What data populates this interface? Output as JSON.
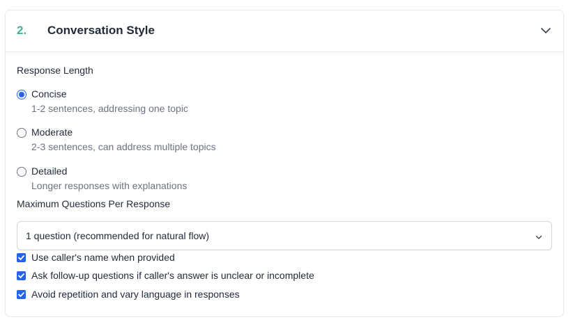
{
  "section": {
    "number": "2.",
    "title": "Conversation Style"
  },
  "response_length": {
    "label": "Response Length",
    "options": [
      {
        "label": "Concise",
        "description": "1-2 sentences, addressing one topic",
        "selected": true
      },
      {
        "label": "Moderate",
        "description": "2-3 sentences, can address multiple topics",
        "selected": false
      },
      {
        "label": "Detailed",
        "description": "Longer responses with explanations",
        "selected": false
      }
    ]
  },
  "max_questions": {
    "label": "Maximum Questions Per Response",
    "selected_value": "1 question (recommended for natural flow)"
  },
  "checkboxes": [
    {
      "label": "Use caller's name when provided",
      "checked": true
    },
    {
      "label": "Ask follow-up questions if caller's answer is unclear or incomplete",
      "checked": true
    },
    {
      "label": "Avoid repetition and vary language in responses",
      "checked": true
    }
  ],
  "colors": {
    "accent_step": "#3fb59a",
    "primary": "#2563eb",
    "border": "#e5e7eb",
    "muted_text": "#6b7280"
  }
}
